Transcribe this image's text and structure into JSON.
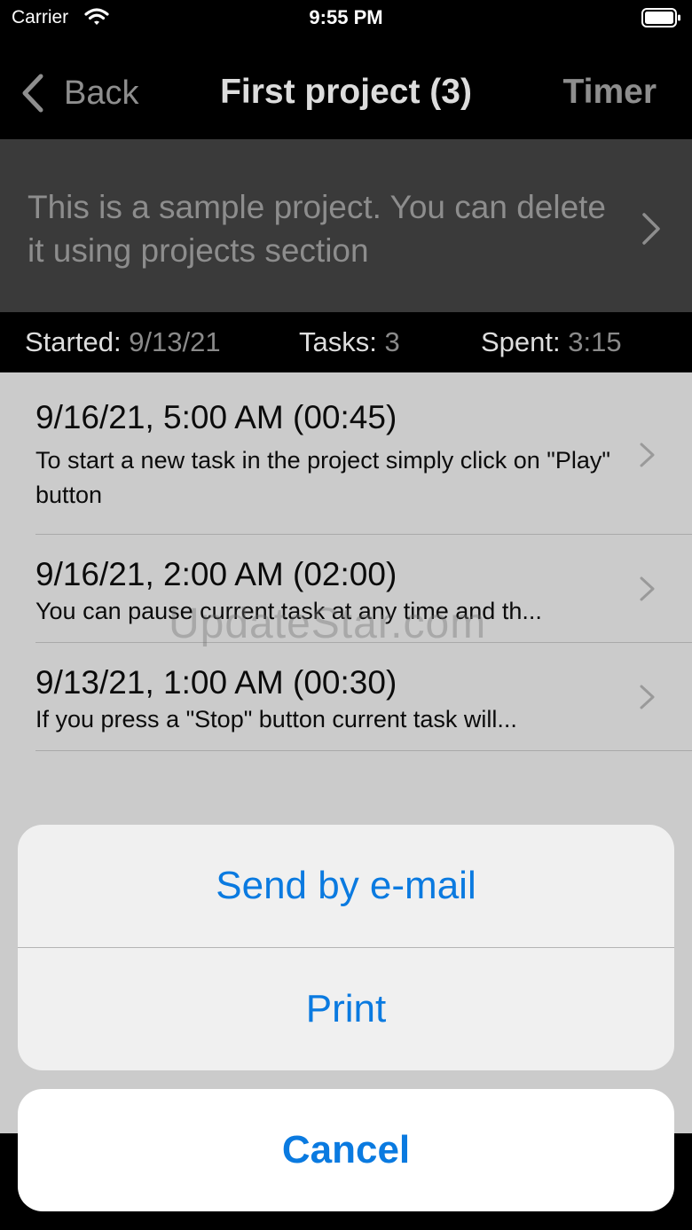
{
  "status_bar": {
    "carrier": "Carrier",
    "time": "9:55 PM"
  },
  "nav": {
    "back_label": "Back",
    "title": "First project (3)",
    "timer_label": "Timer"
  },
  "project": {
    "description": "This is a sample project. You can delete it using projects section"
  },
  "stats": {
    "started_label": "Started:",
    "started_value": "9/13/21",
    "tasks_label": "Tasks:",
    "tasks_value": "3",
    "spent_label": "Spent:",
    "spent_value": "3:15"
  },
  "tasks": [
    {
      "title": "9/16/21, 5:00 AM (00:45)",
      "description": "To start a new task in the project simply click on \"Play\" button"
    },
    {
      "title": "9/16/21, 2:00 AM (02:00)",
      "description": "You can pause current task at any time and th..."
    },
    {
      "title": "9/13/21, 1:00 AM (00:30)",
      "description": "If you press a \"Stop\" button current task will..."
    }
  ],
  "watermark": "UpdateStar.com",
  "action_sheet": {
    "send_email": "Send by e-mail",
    "print": "Print",
    "cancel": "Cancel"
  },
  "colors": {
    "accent": "#0a7ae0",
    "description_bg": "#3a3a3a",
    "list_bg": "#cbcbcb"
  }
}
